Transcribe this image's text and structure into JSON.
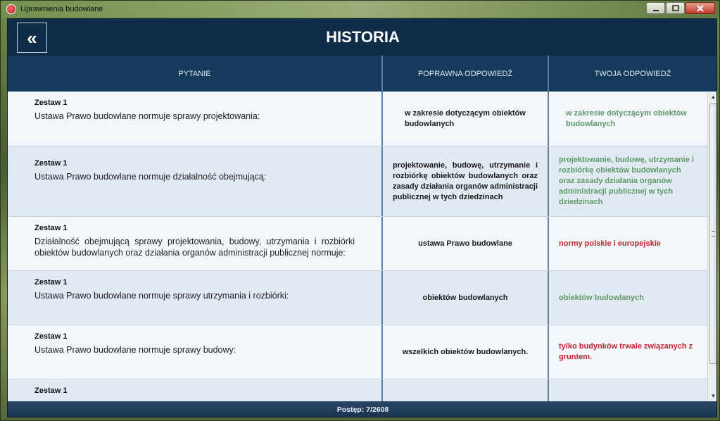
{
  "window": {
    "title": "Uprawnienia budowlane"
  },
  "header": {
    "back_icon": "«",
    "title": "HISTORIA"
  },
  "columns": {
    "question": "PYTANIE",
    "correct": "POPRAWNA ODPOWIEDŹ",
    "yours": "TWOJA ODPOWIEDŹ"
  },
  "rows": [
    {
      "set": "Zestaw 1",
      "question": "Ustawa Prawo budowlane normuje sprawy projektowania:",
      "correct": "w zakresie dotyczącym obiektów budowlanych",
      "yours": "w zakresie dotyczącym obiektów budowlanych",
      "yours_status": "correct"
    },
    {
      "set": "Zestaw 1",
      "question": "Ustawa Prawo budowlane normuje działalność obejmującą:",
      "correct": "projektowanie, budowę, utrzymanie i rozbiórkę obiektów budowlanych oraz zasady działania organów administracji publicznej w tych dziedzinach",
      "yours": "projektowanie, budowę, utrzymanie i rozbiórkę obiektów budowlanych oraz zasady działania organów administracji publicznej w tych dziedzinach",
      "yours_status": "correct"
    },
    {
      "set": "Zestaw 1",
      "question": "Działalność obejmującą sprawy projektowania, budowy, utrzymania i rozbiórki obiektów budowlanych oraz działania organów administracji publicznej normuje:",
      "correct": "ustawa Prawo budowlane",
      "yours": "normy polskie i europejskie",
      "yours_status": "wrong"
    },
    {
      "set": "Zestaw 1",
      "question": "Ustawa Prawo budowlane normuje sprawy utrzymania i rozbiórki:",
      "correct": "obiektów budowlanych",
      "yours": "obiektów budowlanych",
      "yours_status": "correct"
    },
    {
      "set": "Zestaw 1",
      "question": "Ustawa Prawo budowlane normuje sprawy budowy:",
      "correct": "wszelkich obiektów budowlanych.",
      "yours": "tylko budynków trwale związanych z gruntem.",
      "yours_status": "wrong"
    },
    {
      "set": "Zestaw 1",
      "question": "",
      "correct": "",
      "yours": "",
      "yours_status": "correct"
    }
  ],
  "footer": {
    "progress_label": "Postęp: 7/2608"
  },
  "colors": {
    "correct": "#5e9a69",
    "wrong": "#c0262d",
    "header_bg": "#0f2d48"
  }
}
